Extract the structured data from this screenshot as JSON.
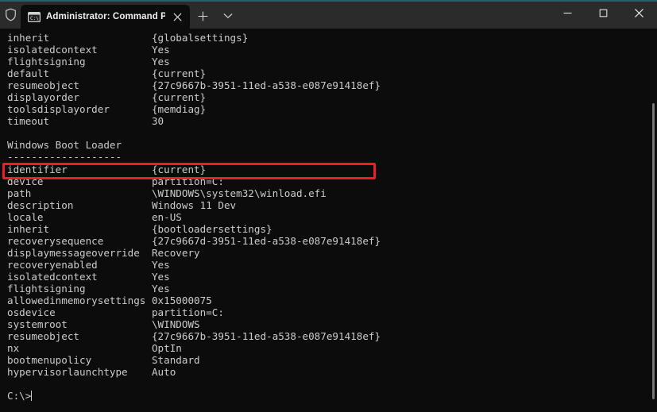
{
  "window": {
    "accent_color": "#2a5f68",
    "titlebar_color": "#2b2b2b",
    "terminal_bg": "#0c0c0c",
    "text_color": "#cccccc",
    "highlight_color": "#e8202a",
    "shield_icon": "shield-icon",
    "tab": {
      "icon": "console-icon",
      "title": "Administrator: Command Pro",
      "close_icon": "close-icon"
    },
    "new_tab_icon": "plus-icon",
    "dropdown_icon": "chevron-down-icon",
    "controls": {
      "minimize_icon": "minimize-icon",
      "maximize_icon": "maximize-icon",
      "close_icon": "close-icon"
    }
  },
  "console": {
    "content": "inherit                 {globalsettings}\nisolatedcontext         Yes\nflightsigning           Yes\ndefault                 {current}\nresumeobject            {27c9667b-3951-11ed-a538-e087e91418ef}\ndisplayorder            {current}\ntoolsdisplayorder       {memdiag}\ntimeout                 30\n\nWindows Boot Loader\n-------------------\nidentifier              {current}\ndevice                  partition=C:\npath                    \\WINDOWS\\system32\\winload.efi\ndescription             Windows 11 Dev\nlocale                  en-US\ninherit                 {bootloadersettings}\nrecoverysequence        {27c9667d-3951-11ed-a538-e087e91418ef}\ndisplaymessageoverride  Recovery\nrecoveryenabled         Yes\nisolatedcontext         Yes\nflightsigning           Yes\nallowedinmemorysettings 0x15000075\nosdevice                partition=C:\nsystemroot              \\WINDOWS\nresumeobject            {27c9667b-3951-11ed-a538-e087e91418ef}\nnx                      OptIn\nbootmenupolicy          Standard\nhypervisorlaunchtype    Auto\n\n",
    "prompt": "C:\\>",
    "highlighted_line": "identifier              {current}",
    "lines": [
      {
        "key": "inherit",
        "value": "{globalsettings}"
      },
      {
        "key": "isolatedcontext",
        "value": "Yes"
      },
      {
        "key": "flightsigning",
        "value": "Yes"
      },
      {
        "key": "default",
        "value": "{current}"
      },
      {
        "key": "resumeobject",
        "value": "{27c9667b-3951-11ed-a538-e087e91418ef}"
      },
      {
        "key": "displayorder",
        "value": "{current}"
      },
      {
        "key": "toolsdisplayorder",
        "value": "{memdiag}"
      },
      {
        "key": "timeout",
        "value": "30"
      },
      {
        "key": "",
        "value": ""
      },
      {
        "key": "Windows Boot Loader",
        "value": ""
      },
      {
        "key": "-------------------",
        "value": ""
      },
      {
        "key": "identifier",
        "value": "{current}"
      },
      {
        "key": "device",
        "value": "partition=C:"
      },
      {
        "key": "path",
        "value": "\\WINDOWS\\system32\\winload.efi"
      },
      {
        "key": "description",
        "value": "Windows 11 Dev"
      },
      {
        "key": "locale",
        "value": "en-US"
      },
      {
        "key": "inherit",
        "value": "{bootloadersettings}"
      },
      {
        "key": "recoverysequence",
        "value": "{27c9667d-3951-11ed-a538-e087e91418ef}"
      },
      {
        "key": "displaymessageoverride",
        "value": "Recovery"
      },
      {
        "key": "recoveryenabled",
        "value": "Yes"
      },
      {
        "key": "isolatedcontext",
        "value": "Yes"
      },
      {
        "key": "flightsigning",
        "value": "Yes"
      },
      {
        "key": "allowedinmemorysettings",
        "value": "0x15000075"
      },
      {
        "key": "osdevice",
        "value": "partition=C:"
      },
      {
        "key": "systemroot",
        "value": "\\WINDOWS"
      },
      {
        "key": "resumeobject",
        "value": "{27c9667b-3951-11ed-a538-e087e91418ef}"
      },
      {
        "key": "nx",
        "value": "OptIn"
      },
      {
        "key": "bootmenupolicy",
        "value": "Standard"
      },
      {
        "key": "hypervisorlaunchtype",
        "value": "Auto"
      }
    ]
  }
}
